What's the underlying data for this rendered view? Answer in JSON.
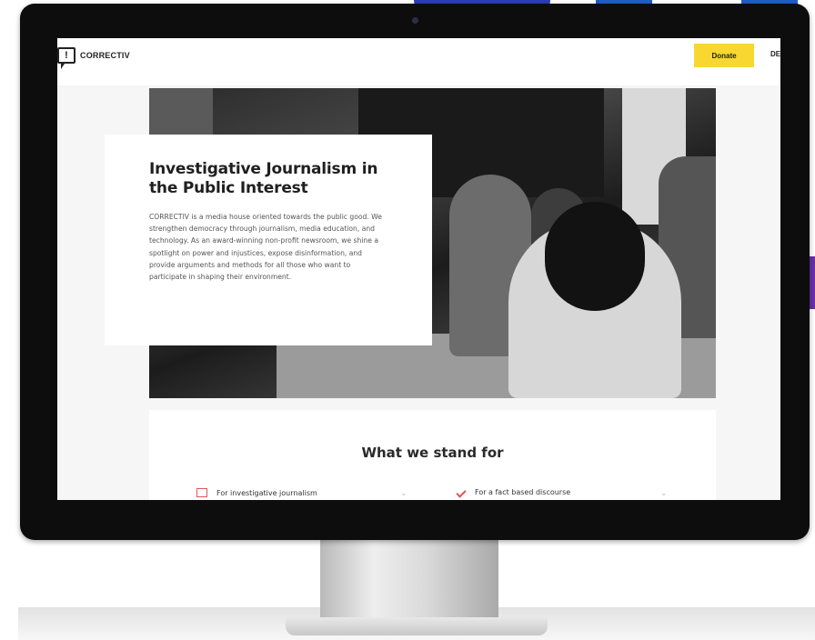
{
  "site": {
    "logo_text": "CORRECTIV",
    "logo_mark": "!",
    "donate_label": "Donate",
    "lang_label": "DE"
  },
  "hero": {
    "title": "Investigative Journalism in the Public Interest",
    "text": "CORRECTIV is a media house oriented towards the public good. We strengthen democracy through journalism, media education, and technology. As an award-winning non-profit newsroom, we shine a spotlight on power and injustices, expose disinformation, and provide arguments and methods for all those who want to participate in shaping their environment."
  },
  "values_section": {
    "title": "What we stand for",
    "items": [
      {
        "label": "For investigative journalism",
        "icon": "document-icon"
      },
      {
        "label": "For a fact based discourse",
        "icon": "check-icon"
      }
    ]
  },
  "colors": {
    "accent": "#f7d730",
    "icon_red": "#e25555"
  }
}
